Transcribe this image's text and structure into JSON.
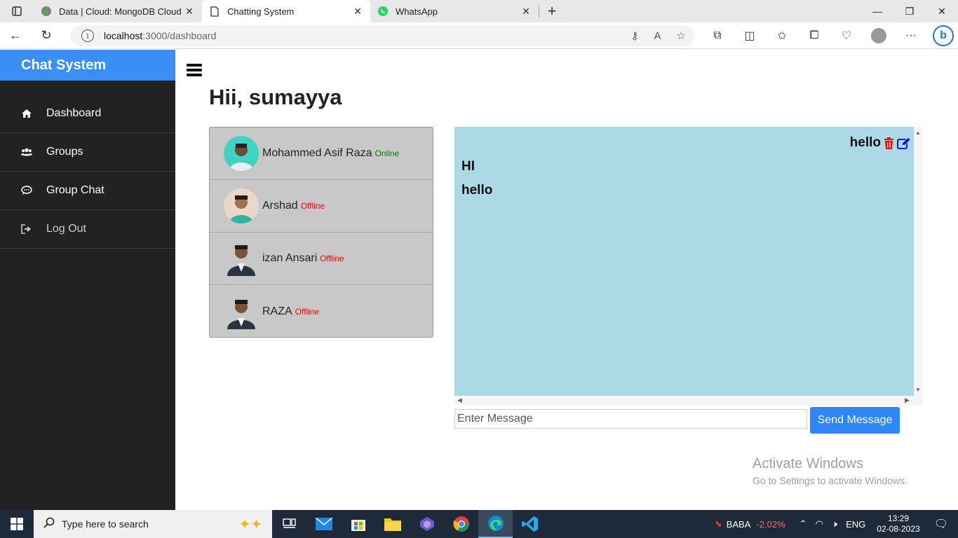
{
  "browser": {
    "tabs": [
      {
        "label": "Data | Cloud: MongoDB Cloud",
        "icon": "mongodb-leaf-icon",
        "active": false
      },
      {
        "label": "Chatting System",
        "icon": "page-icon",
        "active": true
      },
      {
        "label": "WhatsApp",
        "icon": "whatsapp-icon",
        "active": false
      }
    ],
    "url_host": "localhost",
    "url_path": ":3000/dashboard"
  },
  "sidebar": {
    "brand": "Chat System",
    "items": [
      {
        "label": "Dashboard",
        "icon": "home-icon"
      },
      {
        "label": "Groups",
        "icon": "users-icon"
      },
      {
        "label": "Group Chat",
        "icon": "chat-bubble-icon"
      },
      {
        "label": "Log Out",
        "icon": "logout-icon"
      }
    ]
  },
  "main": {
    "greeting": "Hii, sumayya",
    "users": [
      {
        "name": "Mohammed Asif Raza",
        "status": "Online",
        "status_color": "#008000"
      },
      {
        "name": "Arshad",
        "status": "Offline",
        "status_color": "#ff0000"
      },
      {
        "name": "izan Ansari",
        "status": "Offline",
        "status_color": "#ff0000"
      },
      {
        "name": "RAZA",
        "status": "Offline",
        "status_color": "#ff0000"
      }
    ],
    "chat": {
      "sent": "hello",
      "received": [
        "HI",
        "hello"
      ],
      "background": "#add8e6"
    },
    "input_placeholder": "Enter Message",
    "send_label": "Send Message",
    "brand_color": "#3a8ef6"
  },
  "watermark": {
    "line1": "Activate Windows",
    "line2": "Go to Settings to activate Windows."
  },
  "taskbar": {
    "search_placeholder": "Type here to search",
    "stock_name": "BABA",
    "stock_change": "-2.02%",
    "language": "ENG",
    "time": "13:29",
    "date": "02-08-2023"
  }
}
